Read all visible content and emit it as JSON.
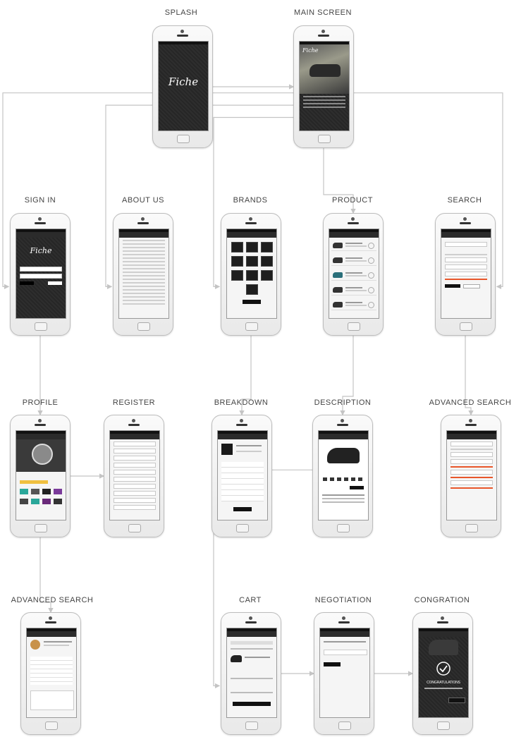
{
  "screens": [
    {
      "id": "splash",
      "label": "SPLASH"
    },
    {
      "id": "main",
      "label": "MAIN SCREEN"
    },
    {
      "id": "signin",
      "label": "SIGN IN"
    },
    {
      "id": "about",
      "label": "ABOUT US"
    },
    {
      "id": "brands",
      "label": "BRANDS"
    },
    {
      "id": "product",
      "label": "PRODUCT"
    },
    {
      "id": "search",
      "label": "SEARCH"
    },
    {
      "id": "profile",
      "label": "PROFILE"
    },
    {
      "id": "register",
      "label": "REGISTER"
    },
    {
      "id": "breakdown",
      "label": "BREAKDOWN"
    },
    {
      "id": "description",
      "label": "DESCRIPTION"
    },
    {
      "id": "advsearch",
      "label": "ADVANCED SEARCH"
    },
    {
      "id": "advsearch2",
      "label": "ADVANCED SEARCH"
    },
    {
      "id": "cart",
      "label": "CART"
    },
    {
      "id": "negotiation",
      "label": "NEGOTIATION"
    },
    {
      "id": "congration",
      "label": "CONGRATION"
    }
  ],
  "app": {
    "logo": "Fiche",
    "congrats_text": "CONGRATULATIONS"
  },
  "connections": [
    [
      "splash",
      "main"
    ],
    [
      "main",
      "signin"
    ],
    [
      "main",
      "about"
    ],
    [
      "main",
      "brands"
    ],
    [
      "main",
      "product"
    ],
    [
      "main",
      "search"
    ],
    [
      "signin",
      "profile"
    ],
    [
      "profile",
      "register"
    ],
    [
      "brands",
      "breakdown"
    ],
    [
      "product",
      "description"
    ],
    [
      "search",
      "advsearch"
    ],
    [
      "profile",
      "advsearch2"
    ],
    [
      "description",
      "cart"
    ],
    [
      "cart",
      "negotiation"
    ],
    [
      "negotiation",
      "congration"
    ]
  ],
  "colors": {
    "connector": "#c4c4c4",
    "screen_dark": "#2a2a2a",
    "accent": "#e8562a"
  }
}
